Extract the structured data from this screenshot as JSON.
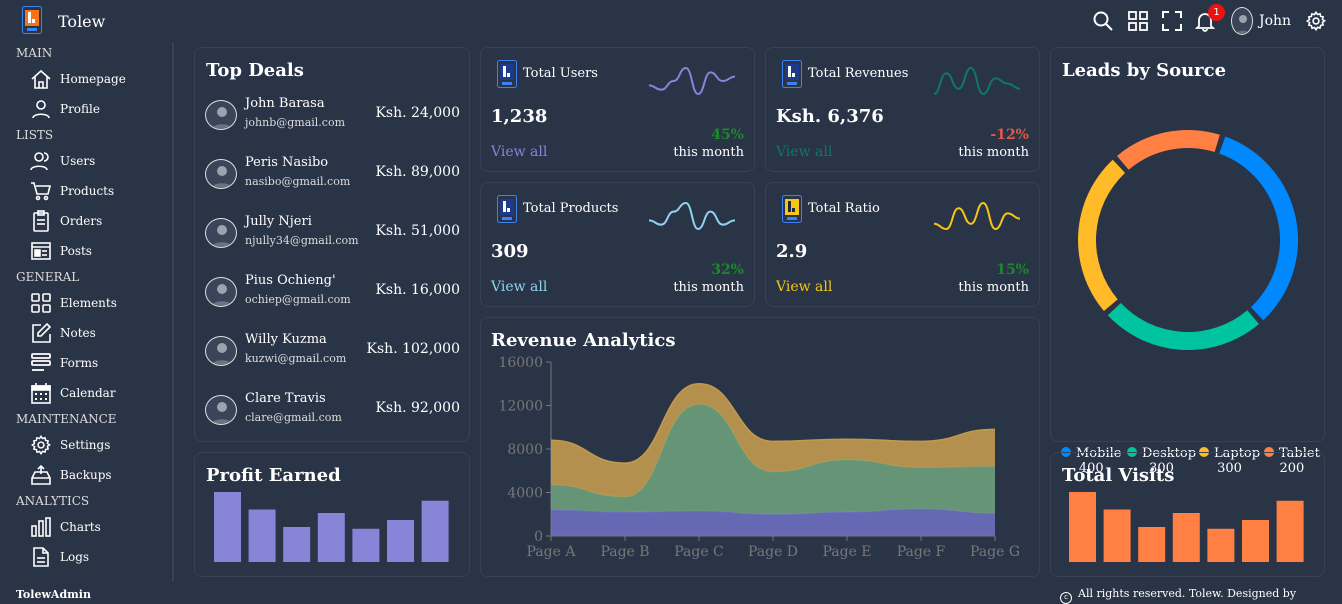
{
  "app": {
    "name": "Tolew",
    "user": "John",
    "notifications": "1"
  },
  "sidebar": {
    "sections": [
      {
        "title": "MAIN",
        "items": [
          {
            "label": "Homepage",
            "icon": "home-icon"
          },
          {
            "label": "Profile",
            "icon": "user-icon"
          }
        ]
      },
      {
        "title": "LISTS",
        "items": [
          {
            "label": "Users",
            "icon": "users-icon"
          },
          {
            "label": "Products",
            "icon": "cart-icon"
          },
          {
            "label": "Orders",
            "icon": "clipboard-icon"
          },
          {
            "label": "Posts",
            "icon": "newspaper-icon"
          }
        ]
      },
      {
        "title": "GENERAL",
        "items": [
          {
            "label": "Elements",
            "icon": "grid-icon"
          },
          {
            "label": "Notes",
            "icon": "edit-icon"
          },
          {
            "label": "Forms",
            "icon": "form-icon"
          },
          {
            "label": "Calendar",
            "icon": "calendar-icon"
          }
        ]
      },
      {
        "title": "MAINTENANCE",
        "items": [
          {
            "label": "Settings",
            "icon": "gear-icon"
          },
          {
            "label": "Backups",
            "icon": "backup-icon"
          }
        ]
      },
      {
        "title": "ANALYTICS",
        "items": [
          {
            "label": "Charts",
            "icon": "chart-icon"
          },
          {
            "label": "Logs",
            "icon": "document-icon"
          }
        ]
      }
    ]
  },
  "top_deals": {
    "title": "Top Deals",
    "items": [
      {
        "name": "John Barasa",
        "email": "johnb@gmail.com",
        "amount": "Ksh. 24,000"
      },
      {
        "name": "Peris Nasibo",
        "email": "nasibo@gmail.com",
        "amount": "Ksh. 89,000"
      },
      {
        "name": "Jully Njeri",
        "email": "njully34@gmail.com",
        "amount": "Ksh. 51,000"
      },
      {
        "name": "Pius Ochieng'",
        "email": "ochiep@gmail.com",
        "amount": "Ksh. 16,000"
      },
      {
        "name": "Willy Kuzma",
        "email": "kuzwi@gmail.com",
        "amount": "Ksh. 102,000"
      },
      {
        "name": "Clare Travis",
        "email": "clare@gmail.com",
        "amount": "Ksh. 92,000"
      }
    ]
  },
  "stats": [
    {
      "title": "Total Users",
      "value": "1,238",
      "link": "View all",
      "percent": "45%",
      "period": "this month",
      "color": "#8884d8",
      "pct_color": "#1a8a2a",
      "spark": [
        3,
        2,
        4,
        7,
        1,
        6,
        4,
        5
      ]
    },
    {
      "title": "Total Revenues",
      "value": "Ksh. 6,376",
      "link": "View all",
      "percent": "-12%",
      "period": "this month",
      "color": "#0f766e",
      "pct_color": "#e05a4a",
      "spark": [
        2,
        6,
        3,
        7,
        2,
        5,
        4,
        3
      ]
    },
    {
      "title": "Total Products",
      "value": "309",
      "link": "View all",
      "percent": "32%",
      "period": "this month",
      "color": "#8fd3f0",
      "pct_color": "#1a8a2a",
      "spark": [
        4,
        3,
        6,
        8,
        2,
        6,
        3,
        4
      ]
    },
    {
      "title": "Total Ratio",
      "value": "2.9",
      "link": "View all",
      "percent": "15%",
      "period": "this month",
      "color": "#f5c518",
      "pct_color": "#1a8a2a",
      "spark": [
        3,
        2,
        6,
        3,
        7,
        2,
        5,
        4
      ]
    }
  ],
  "leads": {
    "title": "Leads by Source",
    "items": [
      {
        "name": "Mobile",
        "value": 400,
        "color": "#0088fe"
      },
      {
        "name": "Desktop",
        "value": 300,
        "color": "#00c49f"
      },
      {
        "name": "Laptop",
        "value": 300,
        "color": "#ffbb28"
      },
      {
        "name": "Tablet",
        "value": 200,
        "color": "#ff8042"
      }
    ]
  },
  "profit": {
    "title": "Profit Earned",
    "color": "#8884d8",
    "values": [
      40,
      30,
      20,
      28,
      19,
      24,
      35
    ]
  },
  "visits": {
    "title": "Total Visits",
    "color": "#ff8042",
    "values": [
      40,
      30,
      20,
      28,
      19,
      24,
      35
    ]
  },
  "revenue_chart_title": "Revenue Analytics",
  "chart_data": {
    "type": "area",
    "stacked": true,
    "categories": [
      "Page A",
      "Page B",
      "Page C",
      "Page D",
      "Page E",
      "Page F",
      "Page G"
    ],
    "ylim": [
      0,
      16000
    ],
    "yticks": [
      0,
      4000,
      8000,
      12000,
      16000
    ],
    "series": [
      {
        "values": [
          2400,
          2200,
          2300,
          2000,
          2200,
          2500,
          2100
        ],
        "color": "#6c6fbf"
      },
      {
        "values": [
          2300,
          1400,
          9800,
          3900,
          4800,
          3800,
          4300
        ],
        "color": "#6b9e7c"
      },
      {
        "values": [
          4100,
          3100,
          1900,
          2800,
          1900,
          2400,
          3400
        ],
        "color": "#c29a4f"
      }
    ]
  },
  "footer": {
    "brand": "TolewAdmin",
    "copyright": "All rights reserved. Tolew. Designed by Waphwebs"
  }
}
